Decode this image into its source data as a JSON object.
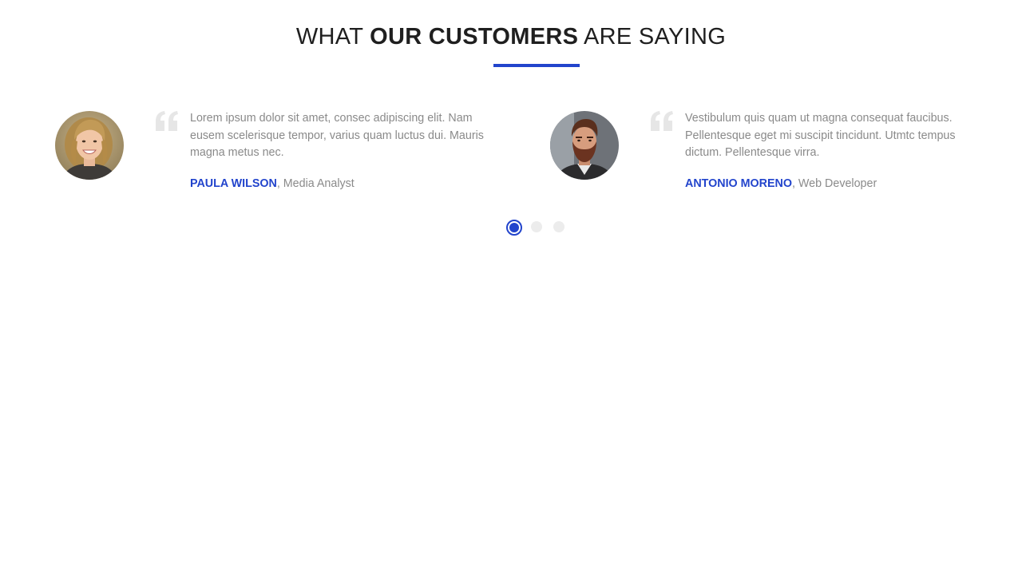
{
  "heading": {
    "part1": "WHAT ",
    "part2": "OUR CUSTOMERS",
    "part3": " ARE SAYING"
  },
  "accent_color": "#2244cc",
  "testimonials": [
    {
      "avatar_icon": "woman-portrait-avatar",
      "quote": "Lorem ipsum dolor sit amet, consec adipiscing elit. Nam eusem scelerisque tempor, varius quam luctus dui. Mauris magna metus nec.",
      "name": "PAULA WILSON",
      "role": ", Media Analyst"
    },
    {
      "avatar_icon": "bearded-man-portrait-avatar",
      "quote": "Vestibulum quis quam ut magna consequat faucibus. Pellentesque eget mi suscipit tincidunt. Utmtc tempus dictum. Pellentesque virra.",
      "name": "ANTONIO MORENO",
      "role": ", Web Developer"
    }
  ],
  "pagination": {
    "pages": 3,
    "active_page": 1
  }
}
